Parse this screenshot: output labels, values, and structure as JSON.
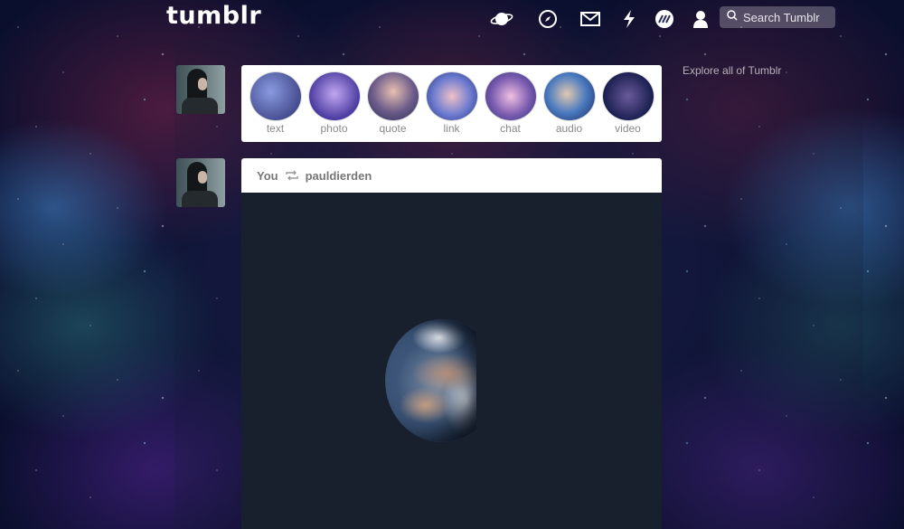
{
  "header": {
    "logo": "tumblr",
    "nav_icons": [
      "planet-icon",
      "compass-icon",
      "mail-icon",
      "lightning-icon",
      "community-icon",
      "account-icon"
    ],
    "search_placeholder": "Search Tumblr"
  },
  "post_types": [
    {
      "label": "text",
      "color": "#4a5aa8"
    },
    {
      "label": "photo",
      "color": "#5a4bbf"
    },
    {
      "label": "quote",
      "color": "#7a6a9a"
    },
    {
      "label": "link",
      "color": "#6a7ad0"
    },
    {
      "label": "chat",
      "color": "#7a5bb0"
    },
    {
      "label": "audio",
      "color": "#4a7ac0"
    },
    {
      "label": "video",
      "color": "#3a3f80"
    }
  ],
  "post": {
    "author": "You",
    "reblogged_from": "pauldierden",
    "reblog_icon": "reblog-icon",
    "image_subject": "earth"
  },
  "sidebar": {
    "explore_text": "Explore all of Tumblr"
  }
}
